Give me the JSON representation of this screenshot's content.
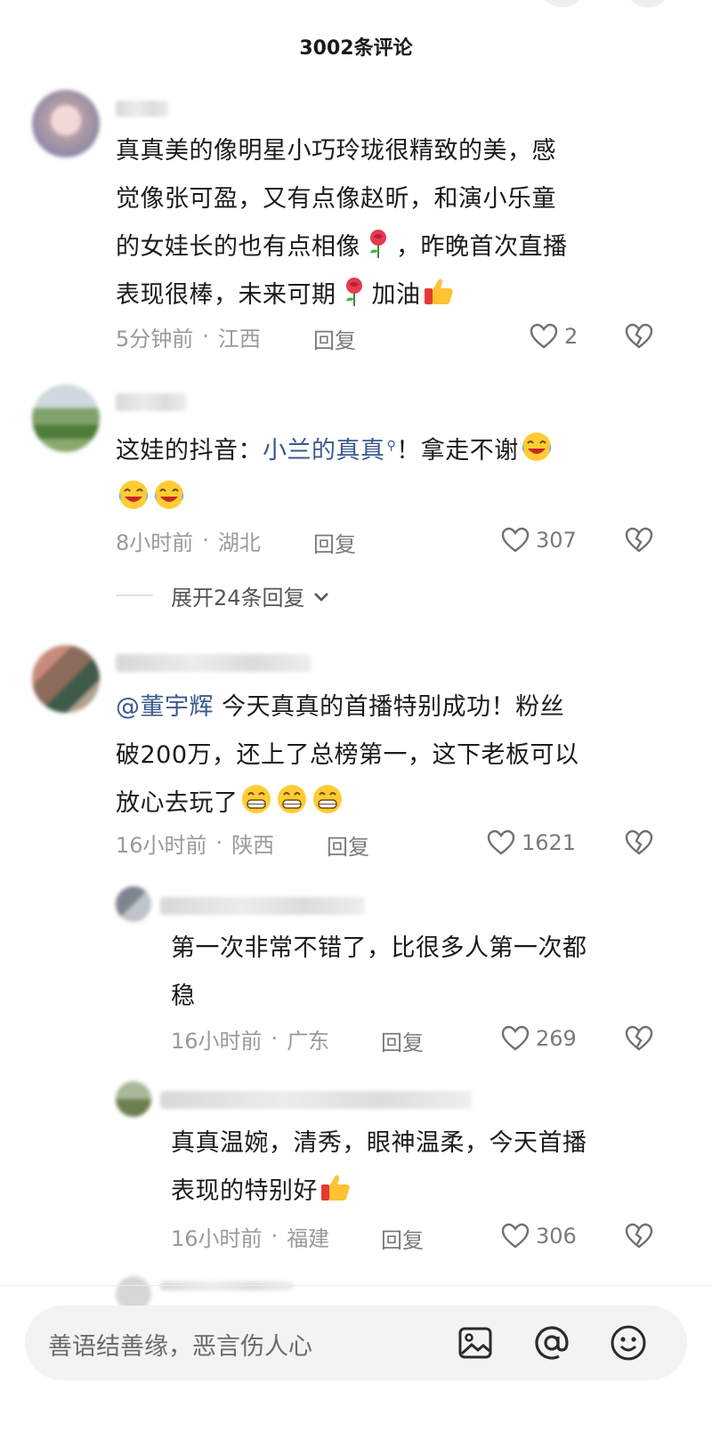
{
  "header": {
    "title": "3002条评论"
  },
  "comments": [
    {
      "text": "真真美的像明星小巧玲珑很精致的美，感觉像张可盈，又有点像赵昕，和演小乐童的女娃长的也有点相像🌹，昨晚首次直播表现很棒，未来可期🌹加油👍",
      "lines": [
        "真真美的像明星小巧玲珑很精致的美，感",
        "觉像张可盈，又有点像赵昕，和演小乐童",
        "的女娃长的也有点相像",
        "，昨晚首次直播",
        "表现很棒，未来可期",
        "加油"
      ],
      "time": "5分钟前",
      "location": "江西",
      "reply": "回复",
      "likes": "2"
    },
    {
      "prefix": "这娃的抖音：",
      "mention": "小兰的真真",
      "suffix": "！拿走不谢",
      "time": "8小时前",
      "location": "湖北",
      "reply": "回复",
      "likes": "307",
      "expand": "展开24条回复"
    },
    {
      "mention": "@董宇辉",
      "line1": " 今天真真的首播特别成功！粉丝",
      "line2": "破200万，还上了总榜第一，这下老板可以",
      "line3": "放心去玩了",
      "time": "16小时前",
      "location": "陕西",
      "reply": "回复",
      "likes": "1621",
      "replies": [
        {
          "line1": "第一次非常不错了，比很多人第一次都",
          "line2": "稳",
          "time": "16小时前",
          "location": "广东",
          "reply": "回复",
          "likes": "269"
        },
        {
          "line1": "真真温婉，清秀，眼神温柔，今天首播",
          "line2": "表现的特别好",
          "time": "16小时前",
          "location": "福建",
          "reply": "回复",
          "likes": "306"
        }
      ]
    }
  ],
  "footer": {
    "placeholder": "善语结善缘，恶言伤人心",
    "icons": [
      "image-icon",
      "at-icon",
      "emoji-icon"
    ]
  },
  "colors": {
    "mention": "#3a5a8c",
    "meta": "#9a9a9a",
    "input_bg": "#f3f3f3"
  }
}
